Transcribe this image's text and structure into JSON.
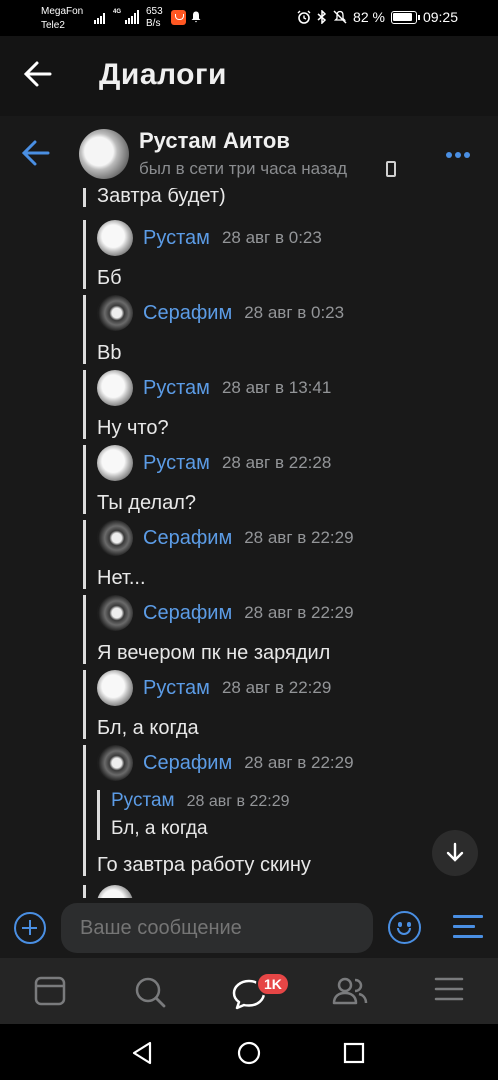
{
  "statusbar": {
    "carrier1": "MegaFon",
    "carrier2": "Tele2",
    "net_label": "4G",
    "speed_value": "653",
    "speed_unit": "B/s",
    "battery": "82 %",
    "time": "09:25"
  },
  "appbar": {
    "title": "Диалоги"
  },
  "chat": {
    "name": "Рустам Аитов",
    "status": "был в сети три часа назад"
  },
  "messages": [
    {
      "text": "Завтра будет)"
    },
    {
      "author": "Рустам",
      "time": "28 авг в 0:23",
      "text": "Бб"
    },
    {
      "author": "Серафим",
      "time": "28 авг в 0:23",
      "text": "Bb"
    },
    {
      "author": "Рустам",
      "time": "28 авг в 13:41",
      "text": "Ну что?"
    },
    {
      "author": "Рустам",
      "time": "28 авг в 22:28",
      "text": "Ты делал?"
    },
    {
      "author": "Серафим",
      "time": "28 авг в 22:29",
      "text": "Нет..."
    },
    {
      "author": "Серафим",
      "time": "28 авг в 22:29",
      "text": "Я вечером пк не зарядил"
    },
    {
      "author": "Рустам",
      "time": "28 авг в 22:29",
      "text": "Бл, а когда"
    },
    {
      "author": "Серафим",
      "time": "28 авг в 22:29",
      "quote": {
        "author": "Рустам",
        "time": "28 авг в 22:29",
        "text": "Бл, а когда"
      },
      "text": "Го завтра работу скину"
    }
  ],
  "composer": {
    "placeholder": "Ваше сообщение"
  },
  "bottomnav": {
    "badge": "1K"
  },
  "colors": {
    "accent": "#4a8fe3",
    "author": "#5c9ce6",
    "badge": "#e64646",
    "background": "#191919"
  }
}
